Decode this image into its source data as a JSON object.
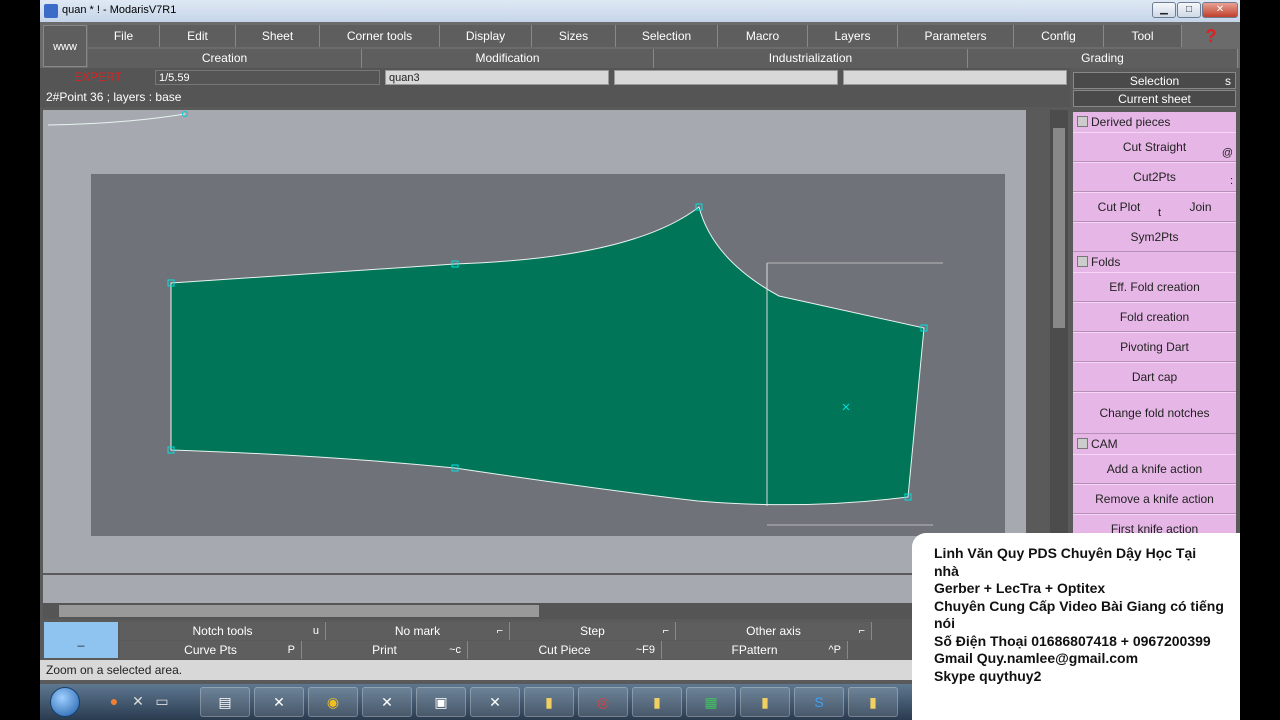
{
  "window": {
    "title": "quan * ! - ModarisV7R1",
    "minimize": "▁",
    "maximize": "□",
    "close": "✕"
  },
  "menubar": {
    "www": "www",
    "menus": [
      "File",
      "Edit",
      "Sheet",
      "Corner tools",
      "Display",
      "Sizes",
      "Selection",
      "Macro",
      "Layers",
      "Parameters",
      "Config",
      "Tool"
    ],
    "help_icon": "?",
    "submenus": [
      "Creation",
      "Modification",
      "Industrialization",
      "Grading"
    ]
  },
  "infobar": {
    "mode": "EXPERT",
    "scale": "1/5.59",
    "piece_name": "quan3",
    "field3": "",
    "field4": ""
  },
  "statusline": "2#Point 36 ;    layers :  base",
  "right_panel": {
    "selection_label": "Selection",
    "selection_shortcut": "s",
    "current_sheet": "Current sheet",
    "sections": [
      {
        "title": "Derived pieces"
      },
      {
        "title": "Folds"
      },
      {
        "title": "CAM"
      }
    ],
    "buttons": {
      "cut_straight": "Cut Straight",
      "cut_straight_sc": "@",
      "cut2pts": "Cut2Pts",
      "cut2pts_sc": ":",
      "cut_plot": "Cut Plot",
      "cut_plot_sc": "t",
      "join": "Join",
      "sym2pts": "Sym2Pts",
      "eff_fold_creation": "Eff. Fold creation",
      "fold_creation": "Fold creation",
      "pivoting_dart": "Pivoting Dart",
      "dart_cap": "Dart cap",
      "change_fold_notches": "Change fold notches",
      "add_knife_action": "Add a knife action",
      "remove_knife_action": "Remove a knife action",
      "first_knife_action": "First knife action"
    }
  },
  "bottom_toolbar": {
    "blank": "_",
    "row1": [
      {
        "label": "Notch tools",
        "shortcut": "u"
      },
      {
        "label": "No mark",
        "shortcut": "⌐"
      },
      {
        "label": "Step",
        "shortcut": "⌐"
      },
      {
        "label": "Other axis",
        "shortcut": "⌐"
      }
    ],
    "row2": [
      {
        "label": "Curve Pts",
        "shortcut": "P"
      },
      {
        "label": "Print",
        "shortcut": "~c"
      },
      {
        "label": "Cut Piece",
        "shortcut": "~F9"
      },
      {
        "label": "FPattern",
        "shortcut": "^P"
      }
    ]
  },
  "hint": "Zoom on a selected area.",
  "colors": {
    "piece_fill": "#007558",
    "piece_stroke": "#e8f4f0",
    "canvas_bg": "#a6aab0",
    "sheet_bg": "#707279",
    "panel_pink": "#e6b6e6",
    "expert_red": "#e02020"
  },
  "taskbar": {
    "icons": [
      "firefox-icon",
      "close-app-icon",
      "monitor-icon",
      "explorer-icon",
      "modaris-icon",
      "chrome-icon",
      "modaris-icon",
      "folder-icon",
      "modaris-icon",
      "notepad-icon",
      "excel-icon",
      "notepad-icon",
      "skype-icon",
      "notepad-icon"
    ]
  },
  "overlay": {
    "lines": [
      "Linh Văn Quy PDS Chuyên Dậy Học Tại nhà",
      "Gerber + LecTra + Optitex",
      "Chuyên Cung Cấp Video Bài Giang có tiếng nói",
      "Số Điện Thoại  01686807418 + 0967200399",
      "Gmail Quy.namlee@gmail.com",
      "Skype quythuy2"
    ]
  }
}
